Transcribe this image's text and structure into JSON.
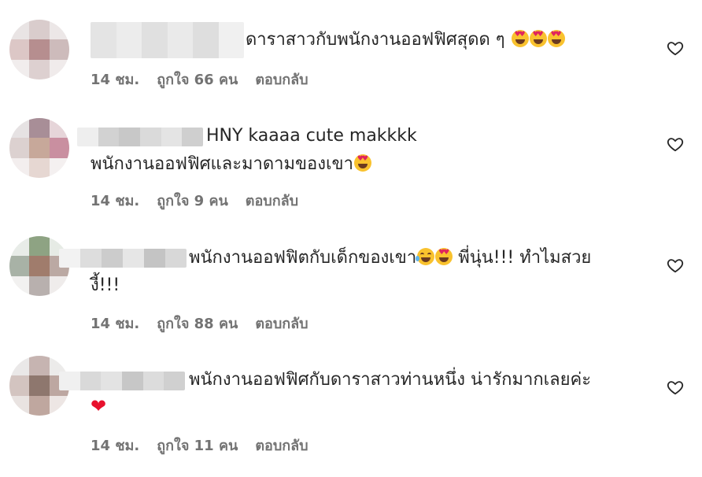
{
  "comments": [
    {
      "text_line1": "ดาราสาวกับพนักงานออฟฟิศสุดด ๆ",
      "text_line2": "",
      "emoji_after_line1": [
        "heart-eyes",
        "heart-eyes",
        "heart-eyes"
      ],
      "time": "14 ชม.",
      "likes": "ถูกใจ 66 คน",
      "reply": "ตอบกลับ"
    },
    {
      "text_line1": "HNY kaaaa cute makkkk",
      "text_line2": "พนักงานออฟฟิศและมาดามของเขา",
      "emoji_after_line2": [
        "heart-eyes"
      ],
      "time": "14 ชม.",
      "likes": "ถูกใจ 9 คน",
      "reply": "ตอบกลับ"
    },
    {
      "text_line1": "พนักงานออฟฟิตกับเด็กของเขา",
      "text_line1_after_emoji": "พี่นุ่น!!! ทำไมสวย",
      "text_line2": "งี้!!!",
      "emoji_in_line1": [
        "tears-of-joy",
        "heart-eyes"
      ],
      "time": "14 ชม.",
      "likes": "ถูกใจ 88 คน",
      "reply": "ตอบกลับ"
    },
    {
      "text_line1": "พนักงานออฟฟิศกับดาราสาวท่านหนึ่ง น่ารักมากเลยค่ะ",
      "text_line2_emoji": "red-heart",
      "time": "14 ชม.",
      "likes": "ถูกใจ 11 คน",
      "reply": "ตอบกลับ"
    }
  ],
  "colors": {
    "text": "#262626",
    "meta": "#737373",
    "emoji_face": "#f9c22e",
    "heart_red": "#e8112d"
  },
  "icons": {
    "like": "heart-outline-icon"
  }
}
